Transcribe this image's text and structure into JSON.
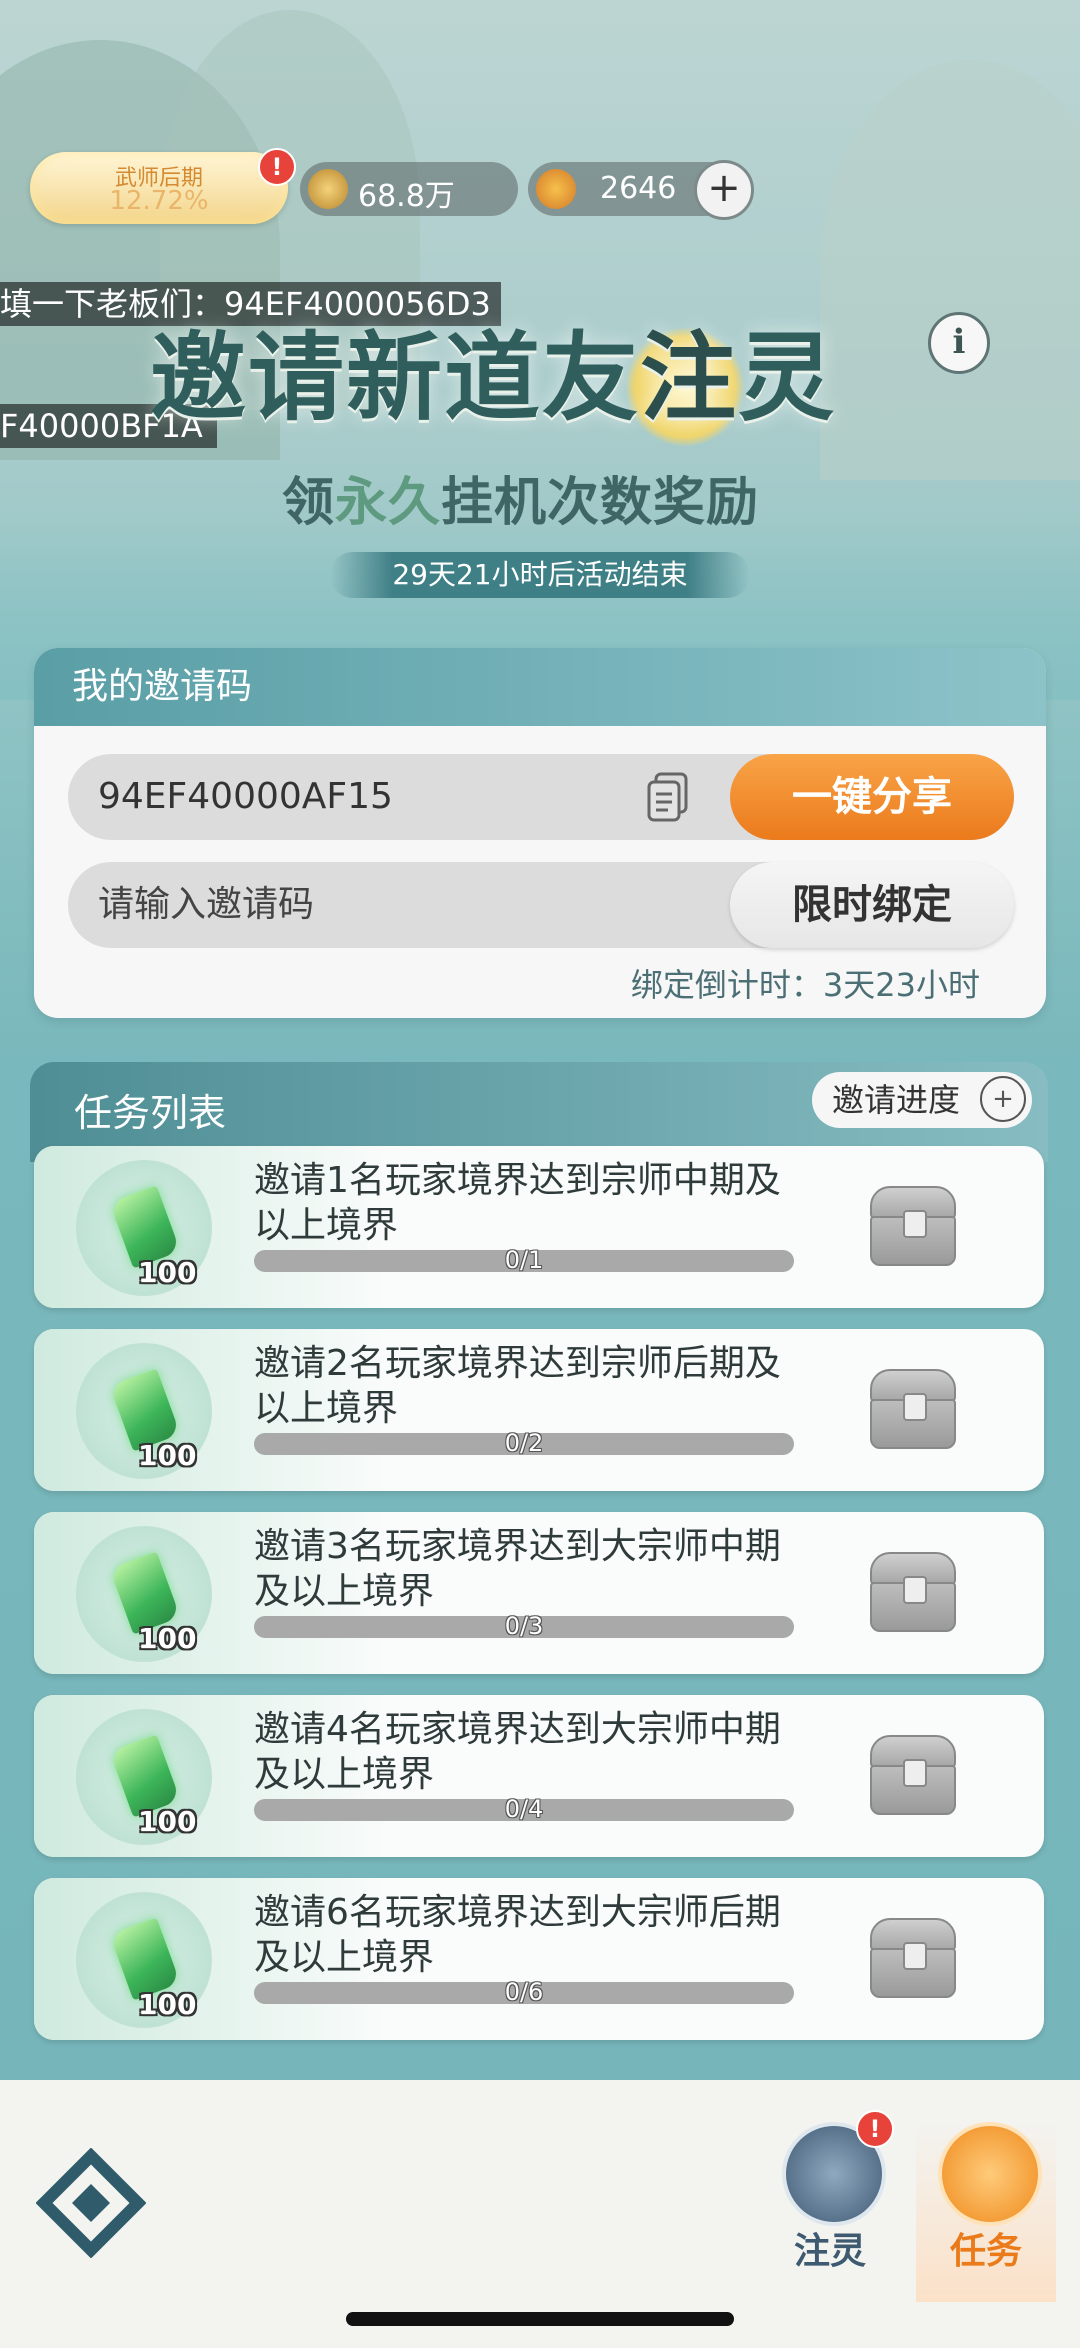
{
  "status": {
    "rank_label": "武师后期",
    "rank_percent": "12.72%",
    "power": "68.8万",
    "currency": "2646",
    "plus_label": "+"
  },
  "tickers": [
    "填一下老板们：94EF4000056D3",
    "F40000BF1A"
  ],
  "banner": {
    "title_pre": "邀请新道友",
    "title_hl": "注",
    "title_post": "灵",
    "info_icon": "i",
    "subtitle_pre": "领",
    "subtitle_hl": "永久",
    "subtitle_post": "挂机次数奖励",
    "countdown": "29天21小时后活动结束"
  },
  "invite": {
    "header": "我的邀请码",
    "code": "94EF40000AF15",
    "share_label": "一键分享",
    "input_placeholder": "请输入邀请码",
    "bind_label": "限时绑定",
    "bind_countdown": "绑定倒计时：3天23小时"
  },
  "tasks": {
    "header": "任务列表",
    "progress_button": "邀请进度",
    "items": [
      {
        "desc": "邀请1名玩家境界达到宗师中期及以上境界",
        "reward": "100",
        "progress": "0/1",
        "fraction": 0
      },
      {
        "desc": "邀请2名玩家境界达到宗师后期及以上境界",
        "reward": "100",
        "progress": "0/2",
        "fraction": 0
      },
      {
        "desc": "邀请3名玩家境界达到大宗师中期及以上境界",
        "reward": "100",
        "progress": "0/3",
        "fraction": 0
      },
      {
        "desc": "邀请4名玩家境界达到大宗师中期及以上境界",
        "reward": "100",
        "progress": "0/4",
        "fraction": 0
      },
      {
        "desc": "邀请6名玩家境界达到大宗师后期及以上境界",
        "reward": "100",
        "progress": "0/6",
        "fraction": 0
      }
    ]
  },
  "nav": {
    "item1": "注灵",
    "item2": "任务",
    "badge": "!"
  },
  "colors": {
    "accent_orange": "#eb7a1c",
    "teal": "#4f8e95",
    "badge_red": "#e8433a"
  }
}
